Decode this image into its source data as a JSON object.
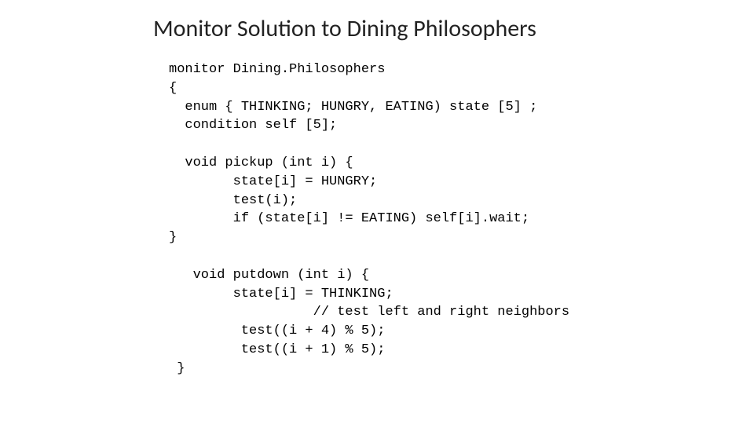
{
  "slide": {
    "title": "Monitor Solution to Dining Philosophers",
    "code_lines": {
      "l0": "monitor Dining.Philosophers",
      "l1": "{",
      "l2": "  enum { THINKING; HUNGRY, EATING) state [5] ;",
      "l3": "  condition self [5];",
      "l4": "",
      "l5": "  void pickup (int i) {",
      "l6": "        state[i] = HUNGRY;",
      "l7": "        test(i);",
      "l8": "        if (state[i] != EATING) self[i].wait;",
      "l9": "}",
      "l10": "",
      "l11": "   void putdown (int i) {",
      "l12": "        state[i] = THINKING;",
      "l13": "                  // test left and right neighbors",
      "l14": "         test((i + 4) % 5);",
      "l15": "         test((i + 1) % 5);",
      "l16": " }"
    }
  }
}
